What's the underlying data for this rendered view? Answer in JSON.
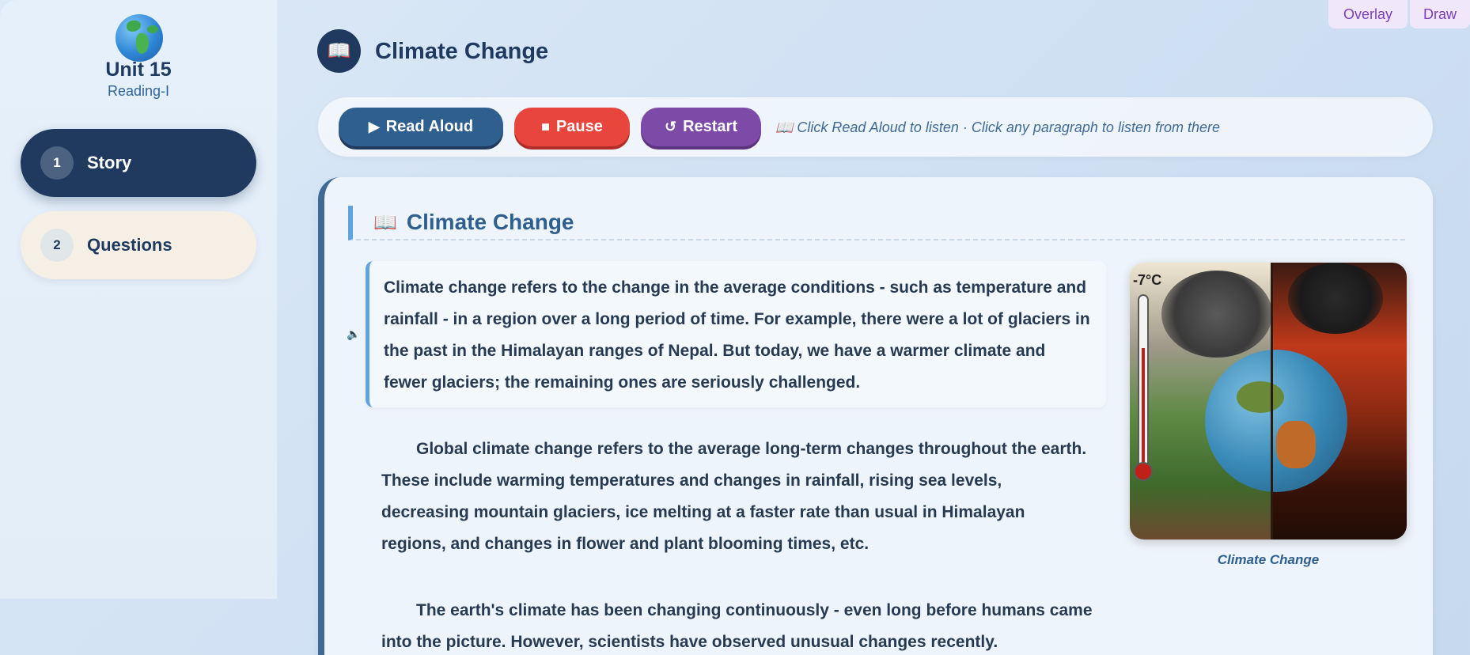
{
  "sidebar": {
    "unit_title": "Unit 15",
    "unit_subtitle": "Reading-I",
    "items": [
      {
        "number": "1",
        "label": "Story",
        "active": true
      },
      {
        "number": "2",
        "label": "Questions",
        "active": false
      }
    ]
  },
  "top_buttons": {
    "overlay": "Overlay",
    "draw": "Draw"
  },
  "header": {
    "icon": "📖",
    "title": "Climate Change"
  },
  "toolbar": {
    "read_icon": "▶",
    "read_label": "Read Aloud",
    "pause_icon": "■",
    "pause_label": "Pause",
    "restart_icon": "↺",
    "restart_label": "Restart",
    "hint": "📖 Click Read Aloud to listen · Click any paragraph to listen from there"
  },
  "story": {
    "section_icon": "📖",
    "section_title": "Climate Change",
    "speaker_icon": "🔈",
    "paragraphs": [
      "Climate change refers to the change in the average conditions - such as temperature and rainfall - in a region over a long period of time. For example, there were a lot of glaciers in the past in the Himalayan ranges of Nepal. But today, we have a warmer climate and fewer glaciers; the remaining ones are seriously challenged.",
      "Global climate change refers to the average long-term changes throughout the earth. These include warming temperatures and changes in rainfall, rising sea levels, decreasing mountain glaciers, ice melting at a faster rate than usual in Himalayan regions, and changes in flower and plant blooming times, etc.",
      "The earth's climate has been changing continuously - even long before humans came into the picture. However, scientists have observed unusual changes recently."
    ],
    "figure_temp": "-7°C",
    "figure_caption": "Climate Change"
  },
  "colors": {
    "navy": "#1f3a5e",
    "read_button": "#2f5f8e",
    "pause_button": "#e8453c",
    "restart_button": "#7d4aa8",
    "accent_blue": "#5fa3e0",
    "overlay_text": "#7b3fb8"
  }
}
